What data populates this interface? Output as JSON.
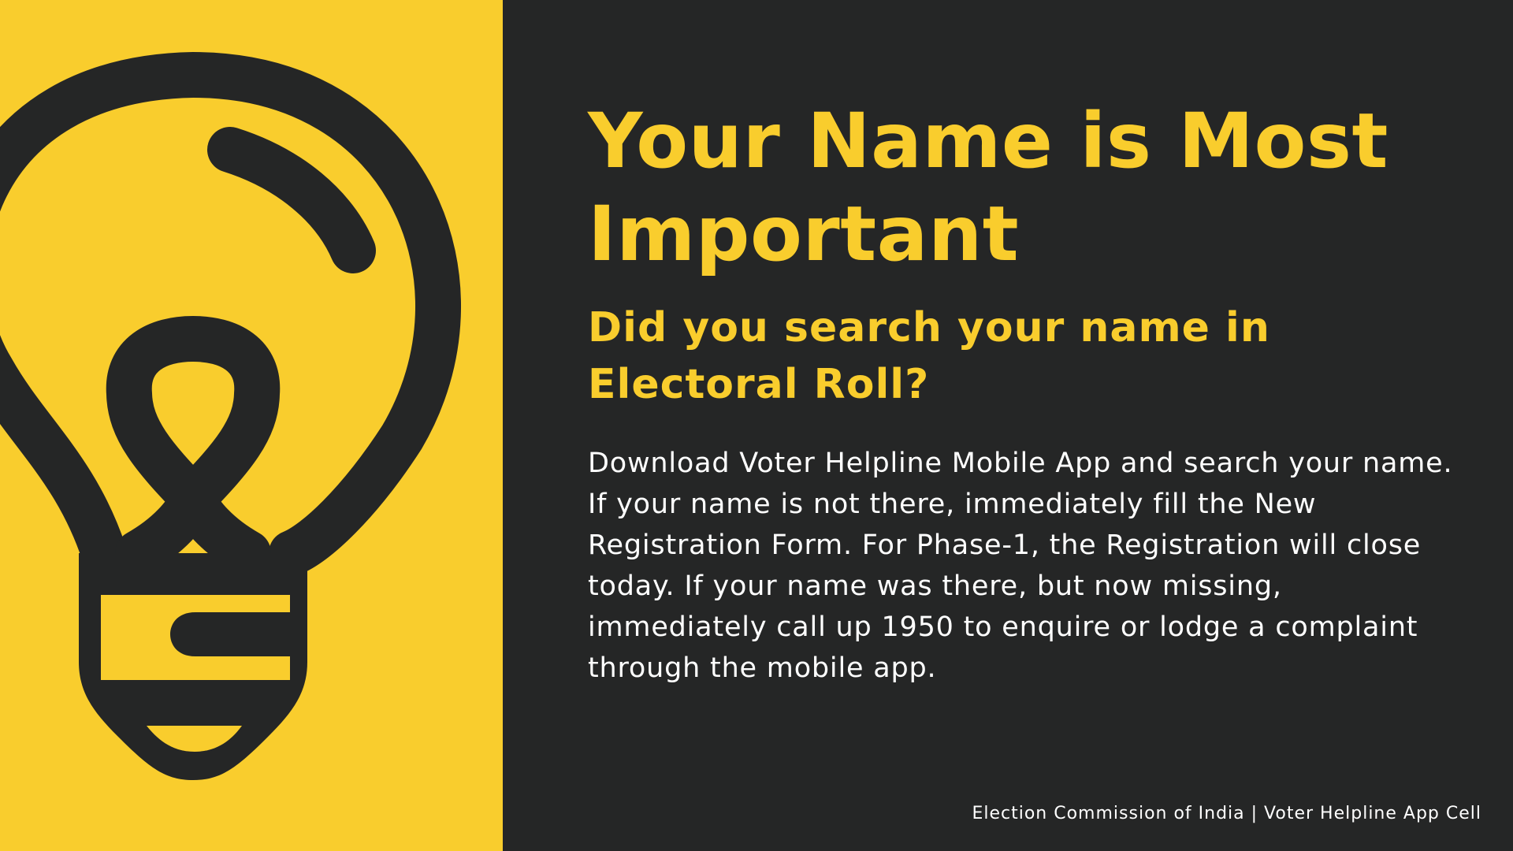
{
  "poster": {
    "headline": "Your Name is Most Important",
    "subheadline": "Did you search your name in Electoral Roll?",
    "body": "Download Voter Helpline Mobile App and search your name. If your name is not there, immediately fill the New Registration Form. For Phase-1, the Registration will close today. If your name was there, but now missing, immediately call up 1950 to enquire or lodge a complaint through the mobile app.",
    "footer": "Election Commission of India | Voter Helpline App Cell"
  },
  "illustration": {
    "icon": "lightbulb-icon"
  },
  "colors": {
    "accent_yellow": "#F9CD2D",
    "background_dark": "#252626",
    "text_white": "#FFFFFF"
  }
}
